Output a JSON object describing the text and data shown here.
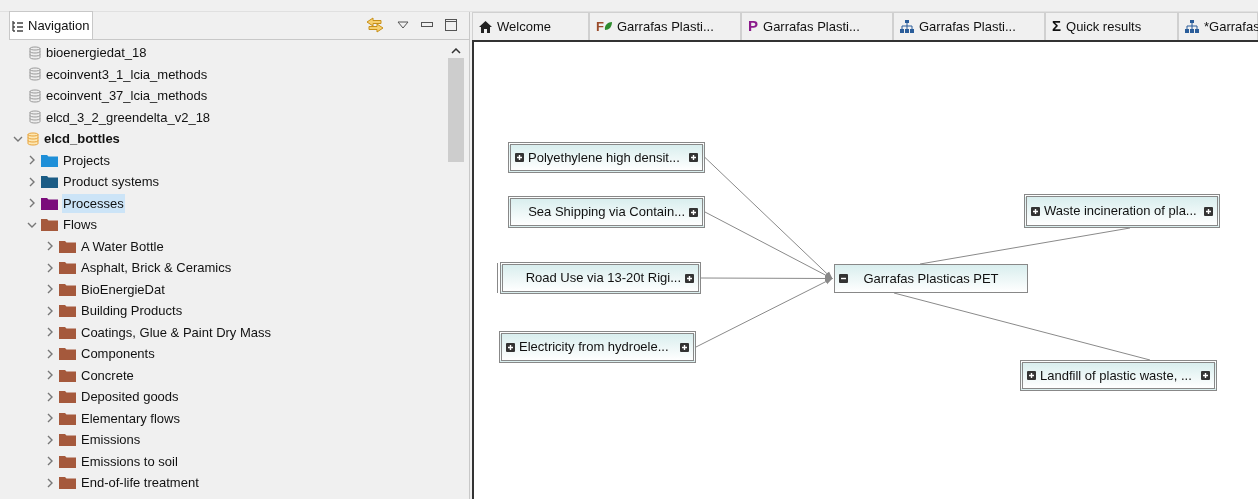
{
  "navigation": {
    "title": "Navigation",
    "tree": [
      {
        "label": "bioenergiedat_18",
        "kind": "database",
        "active": false
      },
      {
        "label": "ecoinvent3_1_lcia_methods",
        "kind": "database",
        "active": false
      },
      {
        "label": "ecoinvent_37_lcia_methods",
        "kind": "database",
        "active": false
      },
      {
        "label": "elcd_3_2_greendelta_v2_18",
        "kind": "database",
        "active": false
      },
      {
        "label": "elcd_bottles",
        "kind": "database",
        "active": true,
        "expanded": true,
        "children": [
          {
            "label": "Projects",
            "kind": "folder",
            "color": "#1e8fd8",
            "expanded": false,
            "selected": false
          },
          {
            "label": "Product systems",
            "kind": "folder",
            "color": "#1b5c85",
            "expanded": false,
            "selected": false
          },
          {
            "label": "Processes",
            "kind": "folder",
            "color": "#7b0c7b",
            "expanded": false,
            "selected": true
          },
          {
            "label": "Flows",
            "kind": "folder",
            "color": "#a5593c",
            "expanded": true,
            "selected": false,
            "children": [
              {
                "label": "A Water Bottle",
                "kind": "folder",
                "color": "#a5593c",
                "expanded": false,
                "selected": false
              },
              {
                "label": "Asphalt, Brick & Ceramics",
                "kind": "folder",
                "color": "#a5593c",
                "expanded": false,
                "selected": false
              },
              {
                "label": "BioEnergieDat",
                "kind": "folder",
                "color": "#a5593c",
                "expanded": false,
                "selected": false
              },
              {
                "label": "Building Products",
                "kind": "folder",
                "color": "#a5593c",
                "expanded": false,
                "selected": false
              },
              {
                "label": "Coatings, Glue & Paint Dry Mass",
                "kind": "folder",
                "color": "#a5593c",
                "expanded": false,
                "selected": false
              },
              {
                "label": "Components",
                "kind": "folder",
                "color": "#a5593c",
                "expanded": false,
                "selected": false
              },
              {
                "label": "Concrete",
                "kind": "folder",
                "color": "#a5593c",
                "expanded": false,
                "selected": false
              },
              {
                "label": "Deposited goods",
                "kind": "folder",
                "color": "#a5593c",
                "expanded": false,
                "selected": false
              },
              {
                "label": "Elementary flows",
                "kind": "folder",
                "color": "#a5593c",
                "expanded": false,
                "selected": false
              },
              {
                "label": "Emissions",
                "kind": "folder",
                "color": "#a5593c",
                "expanded": false,
                "selected": false
              },
              {
                "label": "Emissions to soil",
                "kind": "folder",
                "color": "#a5593c",
                "expanded": false,
                "selected": false
              },
              {
                "label": "End-of-life treatment",
                "kind": "folder",
                "color": "#a5593c",
                "expanded": false,
                "selected": false
              }
            ]
          }
        ]
      }
    ]
  },
  "editor_tabs": [
    {
      "label": "Welcome",
      "kind": "home"
    },
    {
      "label": "Garrafas Plasti...",
      "kind": "flow",
      "glyph": "F"
    },
    {
      "label": "Garrafas Plasti...",
      "kind": "process",
      "glyph": "P"
    },
    {
      "label": "Garrafas Plasti...",
      "kind": "graph"
    },
    {
      "label": "Quick results",
      "kind": "results",
      "glyph": "Σ"
    },
    {
      "label": "*Garrafas",
      "kind": "graph"
    }
  ],
  "graph": {
    "nodes": [
      {
        "label": "Polyethylene high densit...",
        "kind": "input",
        "inputs_expanded": false,
        "outputs_expanded": false
      },
      {
        "label": "Sea Shipping via Contain...",
        "kind": "input",
        "outputs_expanded": false
      },
      {
        "label": "Road Use via 13-20t Rigi...",
        "kind": "input",
        "outputs_expanded": false,
        "stacked": true
      },
      {
        "label": "Electricity from hydroele...",
        "kind": "input",
        "inputs_expanded": false,
        "outputs_expanded": false
      },
      {
        "label": "Garrafas Plasticas PET",
        "kind": "reference",
        "inputs_expanded": true
      },
      {
        "label": "Waste incineration of pla...",
        "kind": "output",
        "inputs_expanded": false,
        "outputs_expanded": false
      },
      {
        "label": "Landfill of plastic waste, ...",
        "kind": "output",
        "inputs_expanded": false,
        "outputs_expanded": false
      }
    ]
  }
}
